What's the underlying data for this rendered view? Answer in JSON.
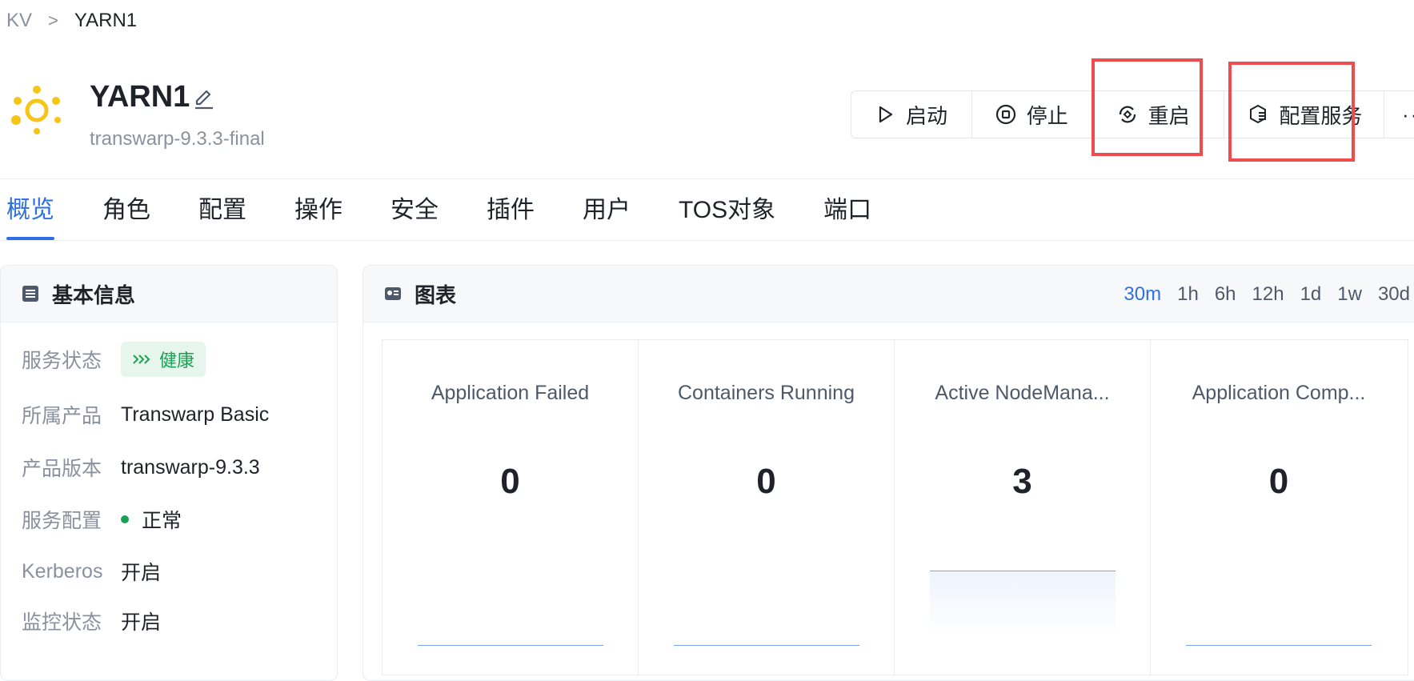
{
  "breadcrumb": {
    "parent": "KV",
    "separator": ">",
    "current": "YARN1"
  },
  "service": {
    "name": "YARN1",
    "version_tag": "transwarp-9.3.3-final"
  },
  "actions": {
    "start": "启动",
    "stop": "停止",
    "restart": "重启",
    "configure": "配置服务",
    "more": "···"
  },
  "tabs": [
    "概览",
    "角色",
    "配置",
    "操作",
    "安全",
    "插件",
    "用户",
    "TOS对象",
    "端口"
  ],
  "basic_info": {
    "title": "基本信息",
    "rows": [
      {
        "label": "服务状态",
        "value": "健康"
      },
      {
        "label": "所属产品",
        "value": "Transwarp Basic"
      },
      {
        "label": "产品版本",
        "value": "transwarp-9.3.3"
      },
      {
        "label": "服务配置",
        "value": "正常"
      },
      {
        "label": "Kerberos",
        "value": "开启"
      },
      {
        "label": "监控状态",
        "value": "开启"
      }
    ]
  },
  "charts": {
    "title": "图表",
    "ranges": [
      "30m",
      "1h",
      "6h",
      "12h",
      "1d",
      "1w",
      "30d"
    ],
    "active_range": "30m",
    "cards": [
      {
        "title": "Application Failed",
        "value": "0"
      },
      {
        "title": "Containers Running",
        "value": "0"
      },
      {
        "title": "Active NodeMana...",
        "value": "3"
      },
      {
        "title": "Application Comp...",
        "value": "0"
      }
    ]
  },
  "colors": {
    "accent": "#2f6fe4",
    "healthy": "#1aa254",
    "highlight": "#ef4d4d"
  }
}
